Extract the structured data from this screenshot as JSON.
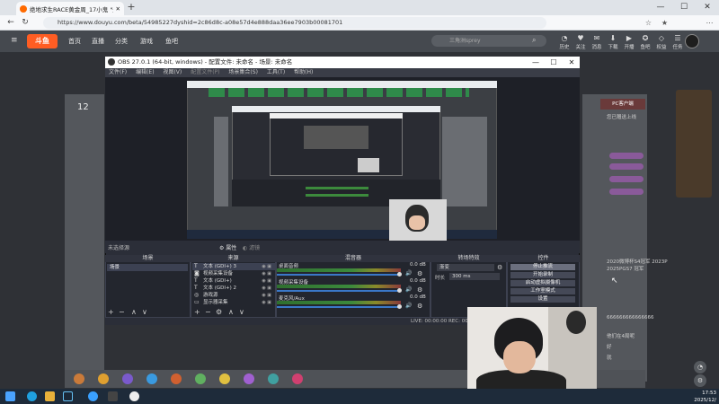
{
  "browser": {
    "tab_title": "绝地求生RACE黄金周_17小鬼 \"运",
    "url": "https://www.douyu.com/beta/54985227dyshid=2c86d8c-a08e57d4e888daa36ee7903b00081701",
    "min": "—",
    "max": "☐",
    "close": "✕",
    "back": "←",
    "reload": "↻",
    "new_tab": "+",
    "star": "☆",
    "collections": "★",
    "more": "⋯"
  },
  "douyu": {
    "logo": "斗鱼",
    "nav": [
      "首页",
      "直播",
      "分类",
      "游戏",
      "鱼吧"
    ],
    "search_placeholder": "三角洲sprey",
    "header_icons": [
      {
        "glyph": "◔",
        "label": "历史"
      },
      {
        "glyph": "♥",
        "label": "关注"
      },
      {
        "glyph": "✉",
        "label": "消息"
      },
      {
        "glyph": "⬇",
        "label": "下载"
      },
      {
        "glyph": "▶",
        "label": "开播"
      },
      {
        "glyph": "✪",
        "label": "鱼吧"
      },
      {
        "glyph": "◇",
        "label": "权益"
      },
      {
        "glyph": "☰",
        "label": "任务"
      }
    ],
    "left_num": "12",
    "right_texts": [
      "PC客户端",
      "您已赠送上线",
      "2020微博杯S4冠军 2023P",
      "2025PGS7 冠军",
      "666666666666666",
      "他们在4局呢",
      "好",
      "就"
    ],
    "sidebar_icons": [
      "◔",
      "⚙"
    ]
  },
  "obs": {
    "title": "OBS 27.0.1 (64-bit, windows) - 配置文件: 未命名 - 场景: 未命名",
    "menu": [
      "文件(F)",
      "编辑(E)",
      "视图(V)",
      "配置文件(P)",
      "场景集合(S)",
      "工具(T)",
      "帮助(H)"
    ],
    "status_left": "未选择源",
    "props_btn": "⚙ 属性",
    "filters_btn": "◐ 滤镜",
    "panels": {
      "scenes": "场景",
      "sources": "来源",
      "mixer": "混音器",
      "transitions": "转场特效",
      "controls": "控件"
    },
    "scene_item": "场景",
    "sources": [
      {
        "icon": "T",
        "name": "文本 (GDI+) 3"
      },
      {
        "icon": "◙",
        "name": "视频采集设备"
      },
      {
        "icon": "T",
        "name": "文本 (GDI+)"
      },
      {
        "icon": "T",
        "name": "文本 (GDI+) 2"
      },
      {
        "icon": "◎",
        "name": "游戏源"
      },
      {
        "icon": "▭",
        "name": "显示器采集"
      }
    ],
    "mixer": [
      {
        "name": "桌面音频",
        "db": "0.0 dB"
      },
      {
        "name": "视频采集设备",
        "db": "0.0 dB"
      },
      {
        "name": "麦克风/Aux",
        "db": "0.0 dB"
      }
    ],
    "transition_type": "渐变",
    "duration_label": "时长",
    "duration_value": "300 ms",
    "controls": [
      "停止推流",
      "开始录制",
      "启动虚拟摄像机",
      "工作室模式",
      "设置"
    ],
    "bottom_status": "LIVE: 00:00:00   REC: 00:00:00   CPU: 3.8%"
  },
  "taskbar": {
    "time": "17:53",
    "date": "2025/12/"
  },
  "colors": {
    "douyu_orange": "#ff5d23",
    "obs_bg": "#2b2e38",
    "taskbar": "#1e2b3a"
  }
}
